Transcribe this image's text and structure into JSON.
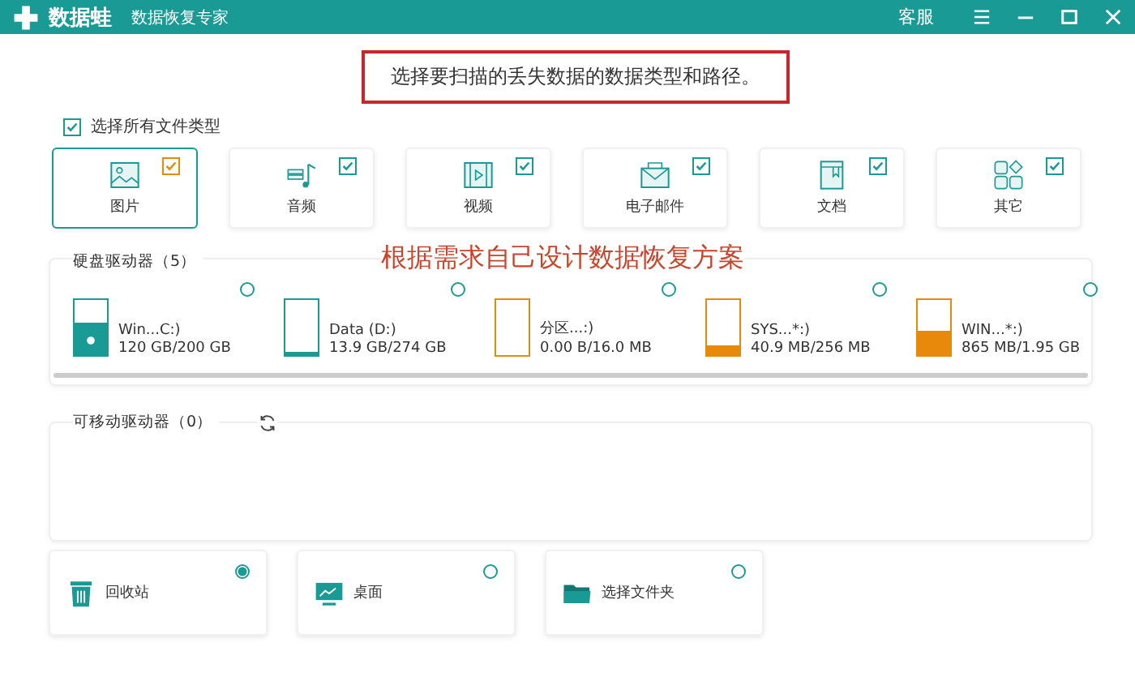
{
  "window": {
    "app_name": "数据蛙",
    "subtitle": "数据恢复专家",
    "support": "客服"
  },
  "instruction": {
    "text": "选择要扫描的丢失数据的数据类型和路径。",
    "highlighted": true
  },
  "select_all": {
    "label": "选择所有文件类型",
    "checked": true
  },
  "file_types": [
    {
      "kind": "image",
      "label": "图片",
      "checked": true,
      "selected": true
    },
    {
      "kind": "audio",
      "label": "音频",
      "checked": true,
      "selected": false
    },
    {
      "kind": "video",
      "label": "视频",
      "checked": true,
      "selected": false
    },
    {
      "kind": "mail",
      "label": "电子邮件",
      "checked": true,
      "selected": false
    },
    {
      "kind": "document",
      "label": "文档",
      "checked": true,
      "selected": false
    },
    {
      "kind": "other",
      "label": "其它",
      "checked": true,
      "selected": false
    }
  ],
  "annotation": "根据需求自己设计数据恢复方案",
  "hard_drives": {
    "title": "硬盘驱动器（5）",
    "drives": [
      {
        "name": "Win...C:)",
        "usage": "120 GB/200 GB",
        "level": 0.6,
        "color": "#1a9a94",
        "system": true,
        "selected": false
      },
      {
        "name": "Data (D:)",
        "usage": "13.9 GB/274 GB",
        "level": 0.05,
        "color": "#1a9a94",
        "system": false,
        "selected": false
      },
      {
        "name": "分区...:)",
        "usage": "0.00  B/16.0 MB",
        "level": 0,
        "color": "#e8890c",
        "system": false,
        "selected": false
      },
      {
        "name": "SYS...*:)",
        "usage": "40.9 MB/256 MB",
        "level": 0.18,
        "color": "#e8890c",
        "system": false,
        "selected": false
      },
      {
        "name": "WIN...*:)",
        "usage": "865 MB/1.95 GB",
        "level": 0.44,
        "color": "#e8890c",
        "system": false,
        "selected": false
      }
    ]
  },
  "removable_drives": {
    "title": "可移动驱动器（0）"
  },
  "locations": [
    {
      "kind": "recycle",
      "label": "回收站",
      "selected": true
    },
    {
      "kind": "desktop",
      "label": "桌面",
      "selected": false
    },
    {
      "kind": "folder",
      "label": "选择文件夹",
      "selected": false
    }
  ]
}
